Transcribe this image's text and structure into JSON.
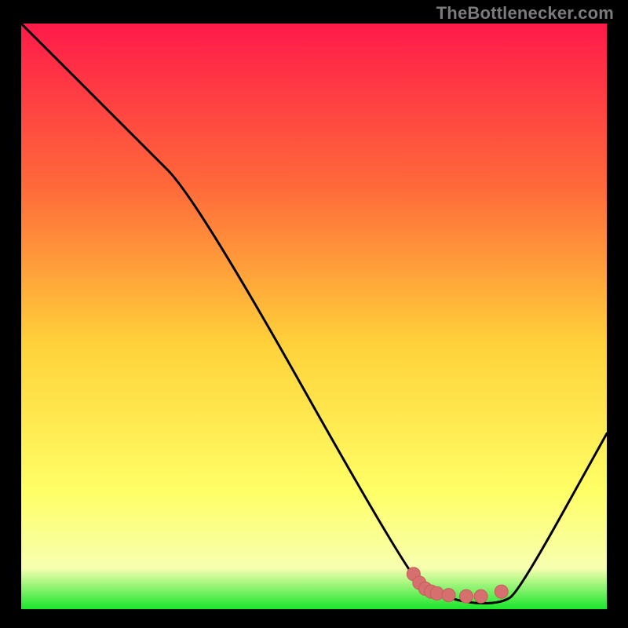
{
  "attribution": {
    "text": "TheBottlenecker.com"
  },
  "colors": {
    "page_bg": "#000000",
    "attribution_text": "#7b7b7b",
    "gradient_top": "#ff1a4a",
    "gradient_mid_upper": "#ff6a3a",
    "gradient_mid": "#ffd23a",
    "gradient_low": "#ffff66",
    "gradient_pale": "#f7ffb0",
    "gradient_green": "#19e62b",
    "curve_stroke": "#000000",
    "marker_fill": "#d6706f",
    "marker_stroke": "#c95b5a"
  },
  "chart_data": {
    "type": "line",
    "title": "",
    "xlabel": "",
    "ylabel": "",
    "xlim": [
      0,
      100
    ],
    "ylim": [
      0,
      100
    ],
    "curve": [
      {
        "x": 0,
        "y": 100
      },
      {
        "x": 20,
        "y": 80
      },
      {
        "x": 30,
        "y": 70
      },
      {
        "x": 66,
        "y": 6
      },
      {
        "x": 70,
        "y": 3
      },
      {
        "x": 76,
        "y": 1
      },
      {
        "x": 82,
        "y": 1
      },
      {
        "x": 85,
        "y": 3
      },
      {
        "x": 100,
        "y": 30
      }
    ],
    "markers": [
      {
        "x": 67,
        "y": 6.0
      },
      {
        "x": 68,
        "y": 4.5
      },
      {
        "x": 69,
        "y": 3.5
      },
      {
        "x": 70,
        "y": 3.0
      },
      {
        "x": 71,
        "y": 2.7
      },
      {
        "x": 73,
        "y": 2.4
      },
      {
        "x": 76,
        "y": 2.2
      },
      {
        "x": 78.5,
        "y": 2.2
      },
      {
        "x": 82,
        "y": 3.0
      }
    ]
  }
}
